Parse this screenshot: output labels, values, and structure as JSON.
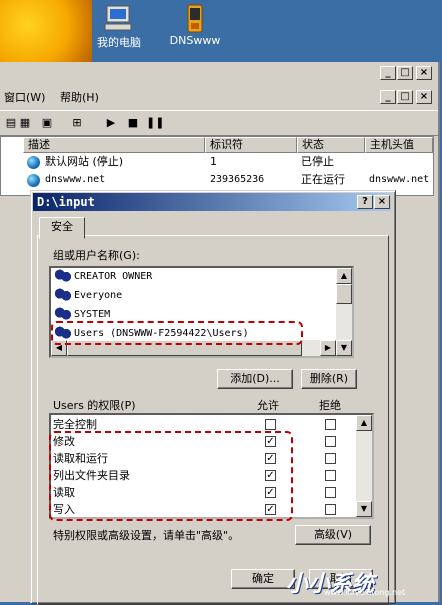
{
  "desktop": {
    "icons": [
      {
        "label": "我的电脑",
        "icon": "computer-icon"
      },
      {
        "label": "DNSwww",
        "icon": "pda-icon"
      }
    ]
  },
  "window": {
    "menu": [
      "窗口(W)",
      "帮助(H)"
    ],
    "caption_buttons": [
      "_",
      "□",
      "×"
    ],
    "list": {
      "columns": [
        "描述",
        "标识符",
        "状态",
        "主机头值"
      ],
      "rows": [
        {
          "desc": "默认网站 (停止)",
          "id": "1",
          "status": "已停止",
          "host": ""
        },
        {
          "desc": "dnswww.net",
          "id": "239365236",
          "status": "正在运行",
          "host": "dnswww.net"
        }
      ]
    }
  },
  "dialog": {
    "title": "D:\\input",
    "help_btn": "?",
    "close_btn": "×",
    "tab": "安全",
    "group_label": "组或用户名称(G):",
    "users": [
      "CREATOR OWNER",
      "Everyone",
      "SYSTEM",
      "Users (DNSWWW-F2594422\\Users)"
    ],
    "add_button": "添加(D)...",
    "remove_button": "删除(R)",
    "perm_label": "Users 的权限(P)",
    "allow_label": "允许",
    "deny_label": "拒绝",
    "permissions": [
      {
        "name": "完全控制",
        "allow": false,
        "deny": false
      },
      {
        "name": "修改",
        "allow": true,
        "deny": false
      },
      {
        "name": "读取和运行",
        "allow": true,
        "deny": false
      },
      {
        "name": "列出文件夹目录",
        "allow": true,
        "deny": false
      },
      {
        "name": "读取",
        "allow": true,
        "deny": false
      },
      {
        "name": "写入",
        "allow": true,
        "deny": false
      }
    ],
    "advanced_note": "特别权限或高级设置，请单击\"高级\"。",
    "advanced_button": "高级(V)",
    "ok_button": "确定",
    "cancel_button": "取消"
  },
  "watermark": {
    "line1": "小小系统",
    "line2": "www.ilovexitong.net"
  },
  "colors": {
    "title_start": "#0a246a",
    "title_end": "#a6caf0",
    "highlight": "#c00000",
    "face": "#d4d0c8"
  }
}
